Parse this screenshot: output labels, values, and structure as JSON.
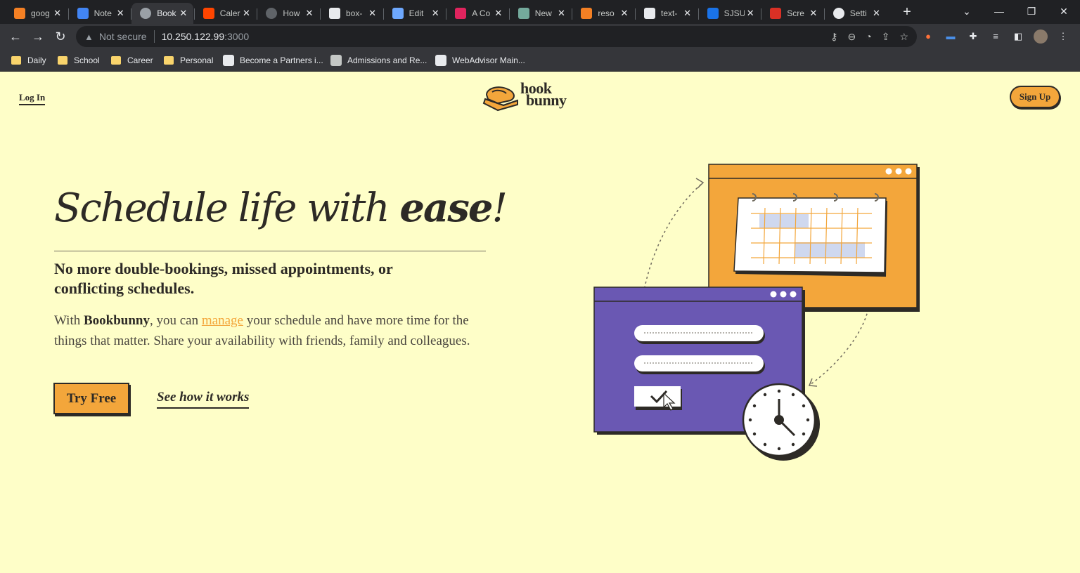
{
  "browser": {
    "tabs": [
      {
        "label": "goog",
        "icon": "stackoverflow-icon",
        "active": false
      },
      {
        "label": "Note",
        "icon": "docs-icon",
        "active": false
      },
      {
        "label": "Book",
        "icon": "globe-icon",
        "active": true
      },
      {
        "label": "Caler",
        "icon": "reddit-icon",
        "active": false
      },
      {
        "label": "How",
        "icon": "loading-icon",
        "active": false
      },
      {
        "label": "box-",
        "icon": "medium-icon",
        "active": false
      },
      {
        "label": "Edit",
        "icon": "cloud-icon",
        "active": false
      },
      {
        "label": "A Co",
        "icon": "asterisk-icon",
        "active": false
      },
      {
        "label": "New",
        "icon": "chatgpt-icon",
        "active": false
      },
      {
        "label": "reso",
        "icon": "stackoverflow-icon",
        "active": false
      },
      {
        "label": "text-",
        "icon": "medium-icon",
        "active": false
      },
      {
        "label": "SJSU",
        "icon": "calendar-icon",
        "active": false
      },
      {
        "label": "Scre",
        "icon": "screencast-icon",
        "active": false
      },
      {
        "label": "Setti",
        "icon": "gear-icon",
        "active": false
      }
    ],
    "address": {
      "security_label": "Not secure",
      "host": "10.250.122.99",
      "port": ":3000"
    },
    "bookmarks": [
      {
        "label": "Daily",
        "type": "folder"
      },
      {
        "label": "School",
        "type": "folder"
      },
      {
        "label": "Career",
        "type": "folder"
      },
      {
        "label": "Personal",
        "type": "folder"
      },
      {
        "label": "Become a Partners i...",
        "type": "link"
      },
      {
        "label": "Admissions and Re...",
        "type": "link"
      },
      {
        "label": "WebAdvisor Main...",
        "type": "link"
      }
    ]
  },
  "site": {
    "nav": {
      "login_label": "Log In",
      "logo_line1": "hook",
      "logo_line2": "bunny",
      "signup_label": "Sign Up"
    },
    "hero": {
      "title_light": "Schedule life with ",
      "title_bold": "ease",
      "title_end": "!",
      "subhead": "No more double-bookings, missed appointments, or conflicting schedules.",
      "body_pre": "With ",
      "body_brand": "Bookbunny",
      "body_mid": ", you can ",
      "body_link": "manage",
      "body_post": " your schedule and have more time for the things that matter. Share your availability with friends, family and colleagues.",
      "cta_primary": "Try Free",
      "cta_secondary": "See how it works"
    }
  },
  "colors": {
    "page_bg": "#fefec8",
    "accent_orange": "#f3a63b",
    "accent_purple": "#6a58b3",
    "ink": "#2d2a26"
  }
}
